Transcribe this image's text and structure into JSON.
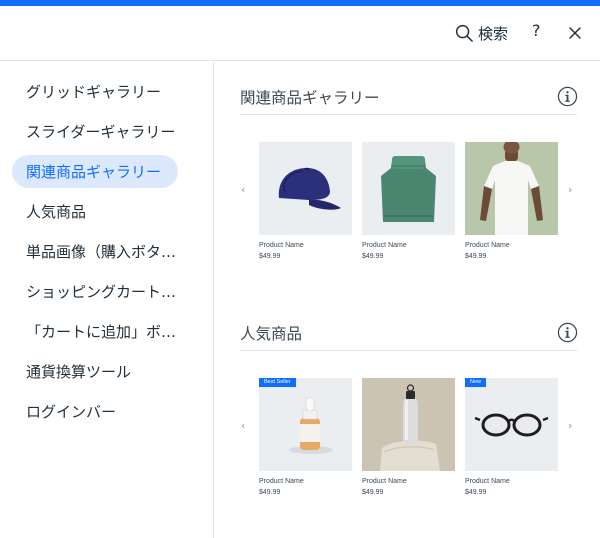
{
  "header": {
    "search_label": "検索",
    "help_label": "?"
  },
  "sidebar": {
    "items": [
      {
        "label": "グリッドギャラリー"
      },
      {
        "label": "スライダーギャラリー"
      },
      {
        "label": "関連商品ギャラリー",
        "selected": true
      },
      {
        "label": "人気商品"
      },
      {
        "label": "単品画像（購入ボタ…"
      },
      {
        "label": "ショッピングカート…"
      },
      {
        "label": "「カートに追加」ボ…"
      },
      {
        "label": "通貨換算ツール"
      },
      {
        "label": "ログインバー"
      }
    ]
  },
  "sections": [
    {
      "title": "関連商品ギャラリー",
      "products": [
        {
          "name": "Product Name",
          "price": "$49.99",
          "image": "cap"
        },
        {
          "name": "Product Name",
          "price": "$49.99",
          "image": "sweater"
        },
        {
          "name": "Product Name",
          "price": "$49.99",
          "image": "tshirt"
        }
      ]
    },
    {
      "title": "人気商品",
      "products": [
        {
          "name": "Product Name",
          "price": "$49.99",
          "image": "dropper-bottle",
          "badge": "Best Seller"
        },
        {
          "name": "Product Name",
          "price": "$49.99",
          "image": "water-bottle"
        },
        {
          "name": "Product Name",
          "price": "$49.99",
          "image": "glasses",
          "badge": "New"
        }
      ]
    }
  ],
  "arrows": {
    "prev": "‹",
    "next": "›"
  },
  "colors": {
    "accent": "#116dff",
    "selected_bg": "#dce9fd",
    "text": "#20303c"
  }
}
